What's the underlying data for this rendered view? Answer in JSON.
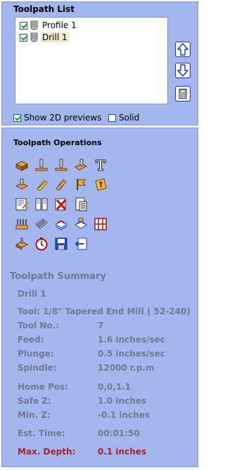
{
  "toolpath_list": {
    "title": "Toolpath List",
    "items": [
      {
        "label": "Profile 1",
        "checked": true,
        "selected": false
      },
      {
        "label": "Drill 1",
        "checked": true,
        "selected": true
      }
    ],
    "side_buttons": [
      "move-up-icon",
      "move-down-icon",
      "calculator-icon"
    ],
    "show_2d_previews": {
      "label": "Show 2D previews",
      "checked": true
    },
    "solid": {
      "label": "Solid",
      "checked": false
    }
  },
  "operations": {
    "title": "Toolpath Operations",
    "rows": [
      [
        "profile-icon",
        "pocket-icon",
        "drill-icon",
        "vcarve-icon",
        "text-icon"
      ],
      [
        "prism-icon",
        "fluting-icon",
        "texture-icon",
        "flag-icon",
        "sign-icon"
      ],
      [
        "gcode-edit-icon",
        "template-icon",
        "delete-icon",
        "calc-icon"
      ],
      [
        "tabs-icon",
        "merge-icon",
        "layer-icon",
        "edit-layer-icon",
        "grid-icon"
      ],
      [
        "preview-icon",
        "time-icon",
        "save-icon",
        "export-icon"
      ]
    ]
  },
  "summary": {
    "title": "Toolpath Summary",
    "name": "Drill 1",
    "tool": "Tool: 1/8\" Tapered End Mill ( 52-240)",
    "rows1": [
      {
        "k": "Tool No.:",
        "v": "7"
      },
      {
        "k": "Feed:",
        "v": "1.6 inches/sec"
      },
      {
        "k": "Plunge:",
        "v": "0.5 inches/sec"
      },
      {
        "k": "Spindle:",
        "v": "12000 r.p.m"
      }
    ],
    "rows2": [
      {
        "k": "Home Pos:",
        "v": "0,0,1.1"
      },
      {
        "k": "Safe Z:",
        "v": "1.0 inches"
      },
      {
        "k": "Min. Z:",
        "v": "-0.1 inches"
      }
    ],
    "est_time": {
      "k": "Est. Time:",
      "v": "00:01:50"
    },
    "max_depth": {
      "k": "Max. Depth:",
      "v": "0.1 inches"
    },
    "warning_color": "#a8262a"
  }
}
